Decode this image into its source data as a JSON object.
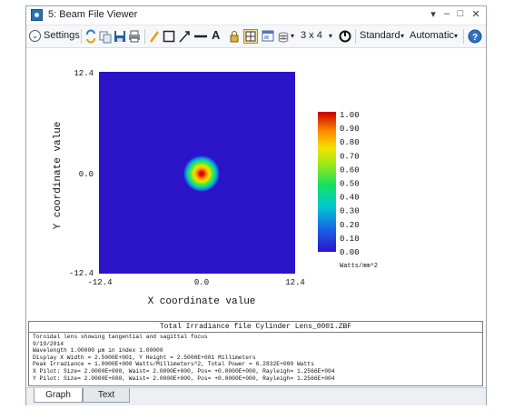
{
  "window": {
    "title": "5: Beam File Viewer",
    "controls": {
      "menu": "▾",
      "minimize": "–",
      "maximize": "□",
      "close": "✕"
    }
  },
  "toolbar": {
    "settings_label": "Settings",
    "layout_label": "3 x 4",
    "standard_label": "Standard",
    "automatic_label": "Automatic",
    "dropdown_glyph": "▾"
  },
  "plot": {
    "ylabel": "Y coordinate value",
    "xlabel": "X coordinate value",
    "y_ticks": [
      "12.4",
      "0.0",
      "-12.4"
    ],
    "x_ticks": [
      "-12.4",
      "0.0",
      "12.4"
    ],
    "colorbar_ticks": [
      "1.00",
      "0.90",
      "0.80",
      "0.70",
      "0.60",
      "0.50",
      "0.40",
      "0.30",
      "0.20",
      "0.10",
      "0.00"
    ],
    "colorbar_unit": "Watts/mm^2",
    "colors": {
      "background": "#2b14c8",
      "peak": "#cc0000"
    }
  },
  "info": {
    "title": "Total Irradiance file Cylinder Lens_0001.ZBF",
    "lines": [
      "Toroidal lens showing tangential and sagittal focus",
      "9/19/2014",
      "Wavelength 1.00000 µm in index 1.00000",
      "Display X Width = 2.5000E+001, Y Height = 2.5000E+001 Millimeters",
      "Peak Irradiance = 1.0000E+000 Watts/Millimeters^2, Total Power = 6.2832E+000 Watts",
      "X Pilot: Size= 2.0000E+000, Waist= 2.0000E+000, Pos= +0.0000E+000, Rayleigh= 1.2566E+004",
      "Y Pilot: Size= 2.0000E+000, Waist= 2.0000E+000, Pos= +0.0000E+000, Rayleigh= 1.2566E+004"
    ]
  },
  "tabs": [
    {
      "label": "Graph",
      "active": true
    },
    {
      "label": "Text",
      "active": false
    }
  ]
}
